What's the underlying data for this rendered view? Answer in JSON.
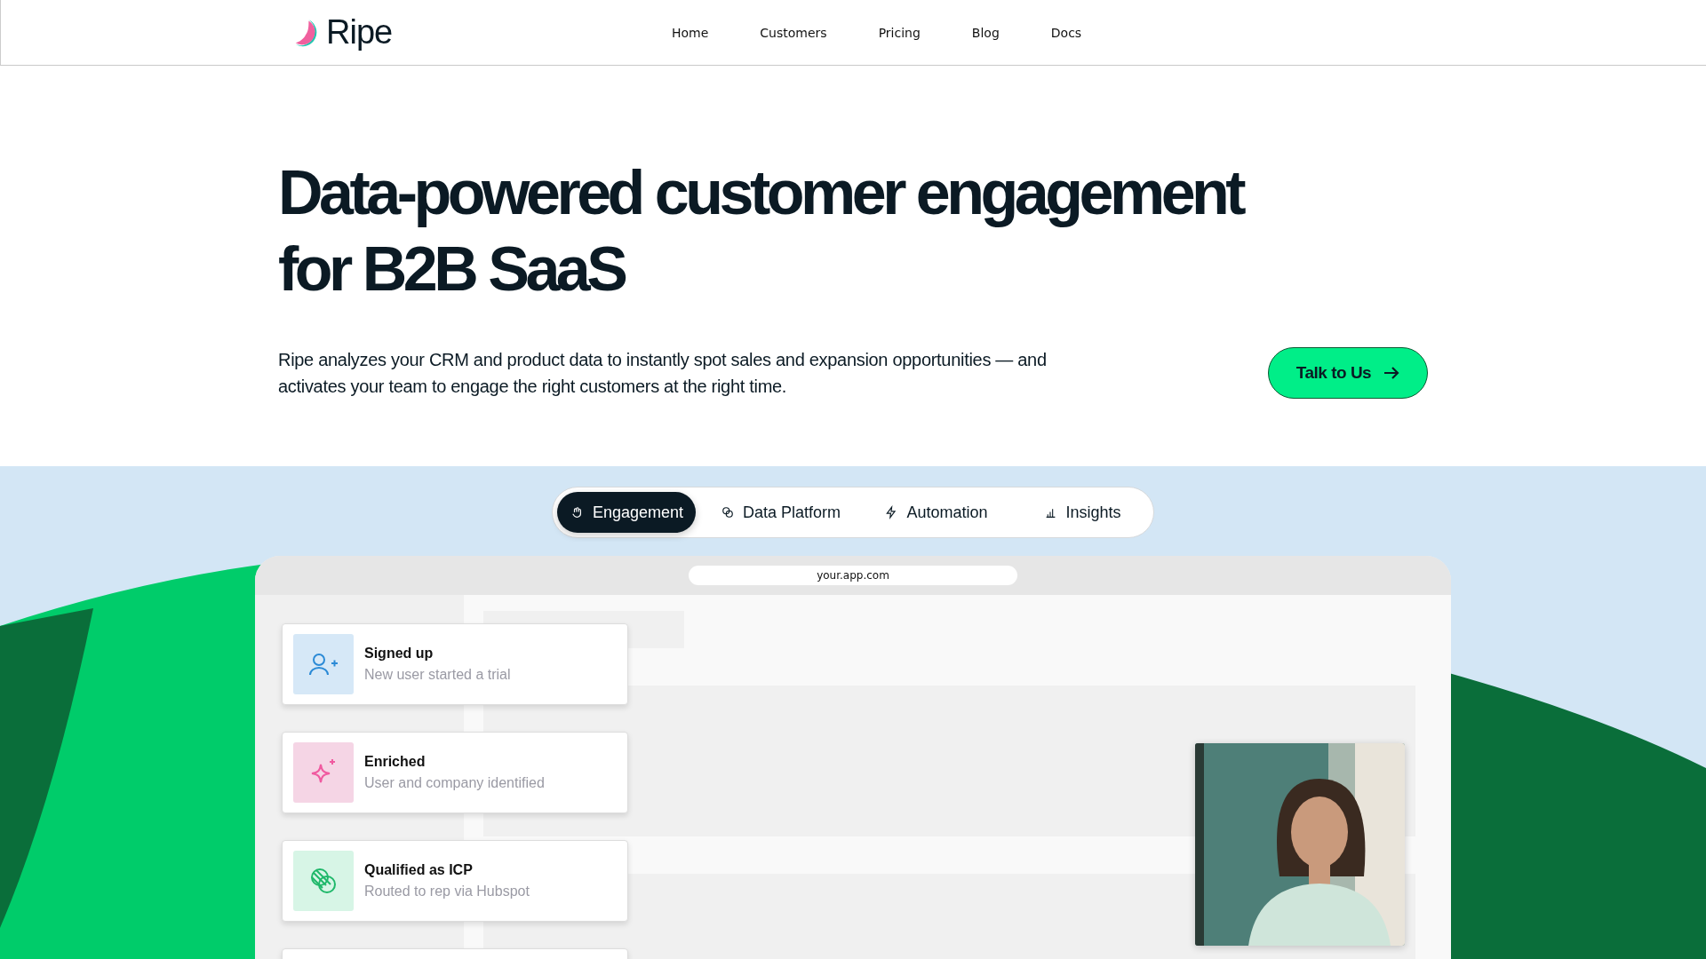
{
  "nav": {
    "logo": "Ripe",
    "links": [
      "Home",
      "Customers",
      "Pricing",
      "Blog",
      "Docs"
    ]
  },
  "hero": {
    "title_lines": [
      "Data-powered customer engagement",
      "for B2B SaaS"
    ],
    "text": "Ripe analyzes your CRM and product data to instantly spot sales and expansion opportunities — and activates your team to engage the right customers at the right time.",
    "cta": "Talk to Us"
  },
  "tabs": [
    {
      "label": "Engagement",
      "selected": true
    },
    {
      "label": "Data Platform",
      "selected": false
    },
    {
      "label": "Automation",
      "selected": false
    },
    {
      "label": "Insights",
      "selected": false
    }
  ],
  "browser": {
    "url": "your.app.com"
  },
  "events": [
    {
      "title": "Signed up",
      "subtitle": "New user started a trial",
      "color": "#d6e8f7"
    },
    {
      "title": "Enriched",
      "subtitle": "User and company identified",
      "color": "#f5d5e5"
    },
    {
      "title": "Qualified as ICP",
      "subtitle": "Routed to rep via Hubspot",
      "color": "#d7f5e6"
    }
  ]
}
